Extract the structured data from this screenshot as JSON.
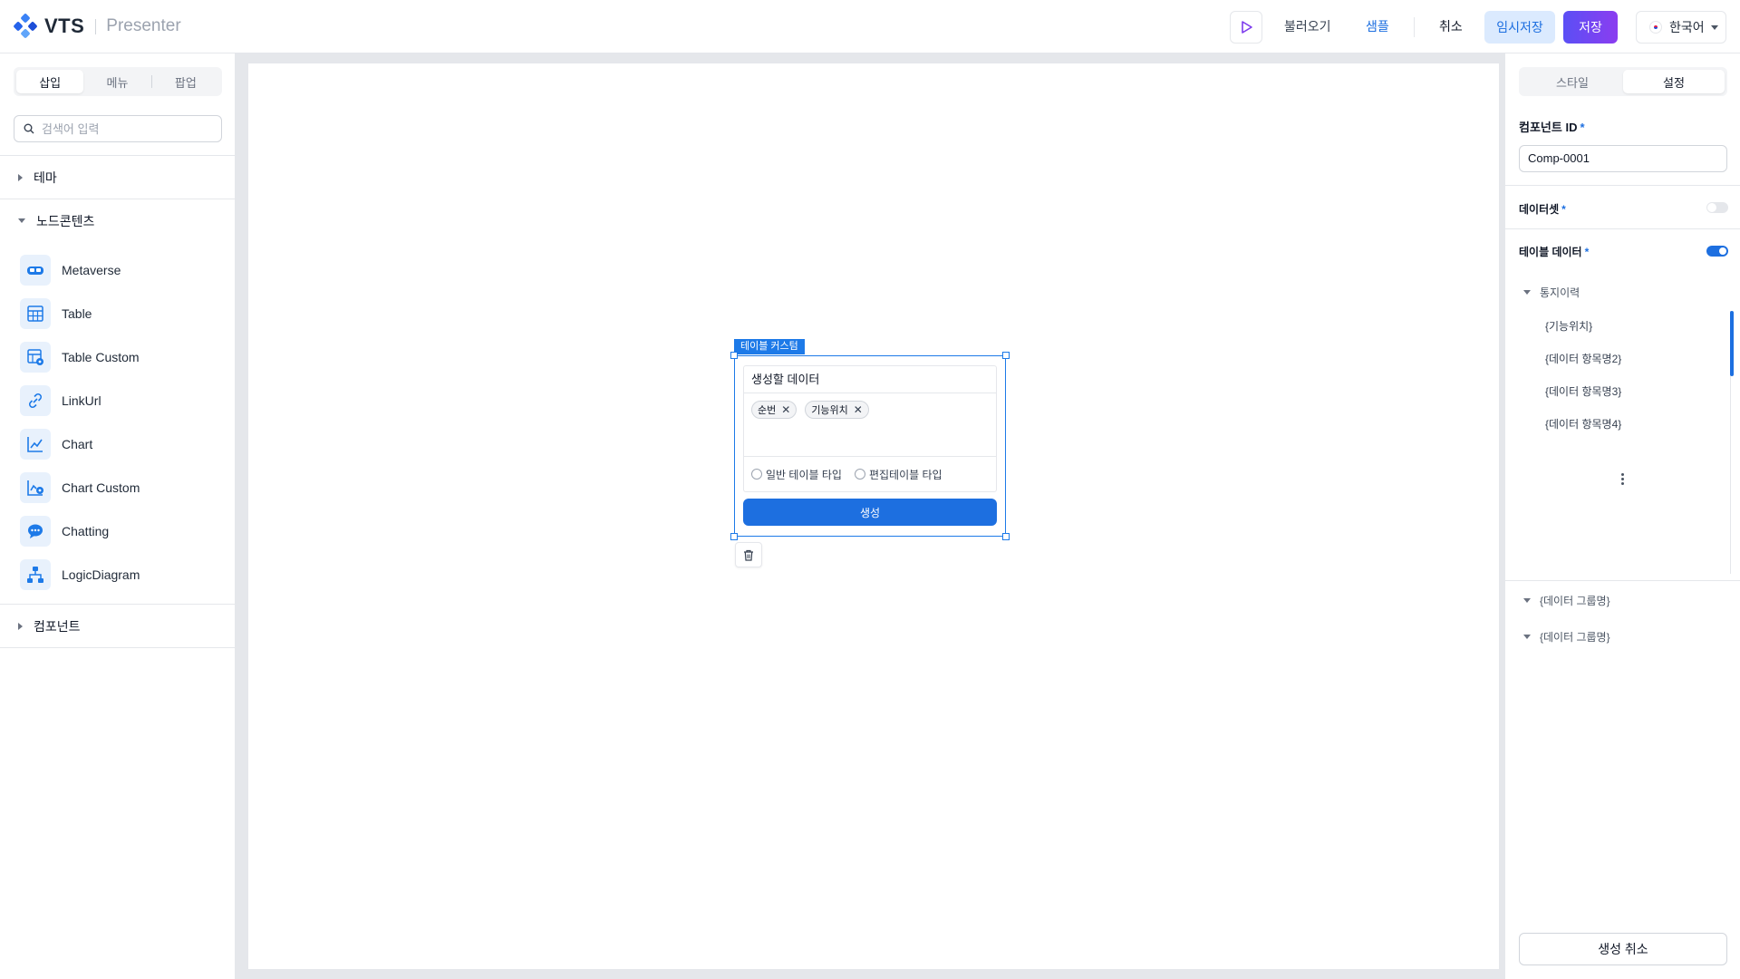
{
  "header": {
    "logo_text": "VTS",
    "app_name": "Presenter",
    "load_label": "불러오기",
    "sample_label": "샘플",
    "cancel_label": "취소",
    "temp_save_label": "임시저장",
    "save_label": "저장",
    "language": "한국어"
  },
  "sidebar": {
    "tabs": [
      "삽입",
      "메뉴",
      "팝업"
    ],
    "active_tab": "삽입",
    "search_placeholder": "검색어 입력",
    "sections": {
      "theme": "테마",
      "node_contents": "노드콘텐츠",
      "components": "컴포넌트"
    },
    "items": [
      {
        "label": "Metaverse",
        "icon": "metaverse-icon"
      },
      {
        "label": "Table",
        "icon": "table-icon"
      },
      {
        "label": "Table Custom",
        "icon": "table-custom-icon"
      },
      {
        "label": "LinkUrl",
        "icon": "link-icon"
      },
      {
        "label": "Chart",
        "icon": "chart-icon"
      },
      {
        "label": "Chart Custom",
        "icon": "chart-custom-icon"
      },
      {
        "label": "Chatting",
        "icon": "chat-icon"
      },
      {
        "label": "LogicDiagram",
        "icon": "logic-diagram-icon"
      }
    ]
  },
  "canvas": {
    "selection_tag": "테이블 커스텀",
    "component": {
      "title": "생성할 데이터",
      "chips": [
        "순번",
        "기능위치"
      ],
      "radio_options": [
        "일반 테이블 타입",
        "편집테이블 타입"
      ],
      "create_label": "생성"
    }
  },
  "right_panel": {
    "tabs": [
      "스타일",
      "설정"
    ],
    "active_tab": "설정",
    "component_id_label": "컴포넌트 ID",
    "component_id_value": "Comp-0001",
    "dataset_label": "데이터셋",
    "dataset_enabled": false,
    "table_data_label": "테이블 데이터",
    "table_data_enabled": true,
    "tree": {
      "group_label": "통지이력",
      "items": [
        "{기능위치}",
        "{데이터 항목명2}",
        "{데이터 항목명3}",
        "{데이터 항목명4}"
      ]
    },
    "data_groups": [
      "{데이터 그룹명}",
      "{데이터 그룹명}"
    ],
    "cancel_create_label": "생성 취소"
  },
  "colors": {
    "accent": "#1d6fe0",
    "save_gradient_start": "#5b4ff5",
    "save_gradient_end": "#8b3df0"
  }
}
